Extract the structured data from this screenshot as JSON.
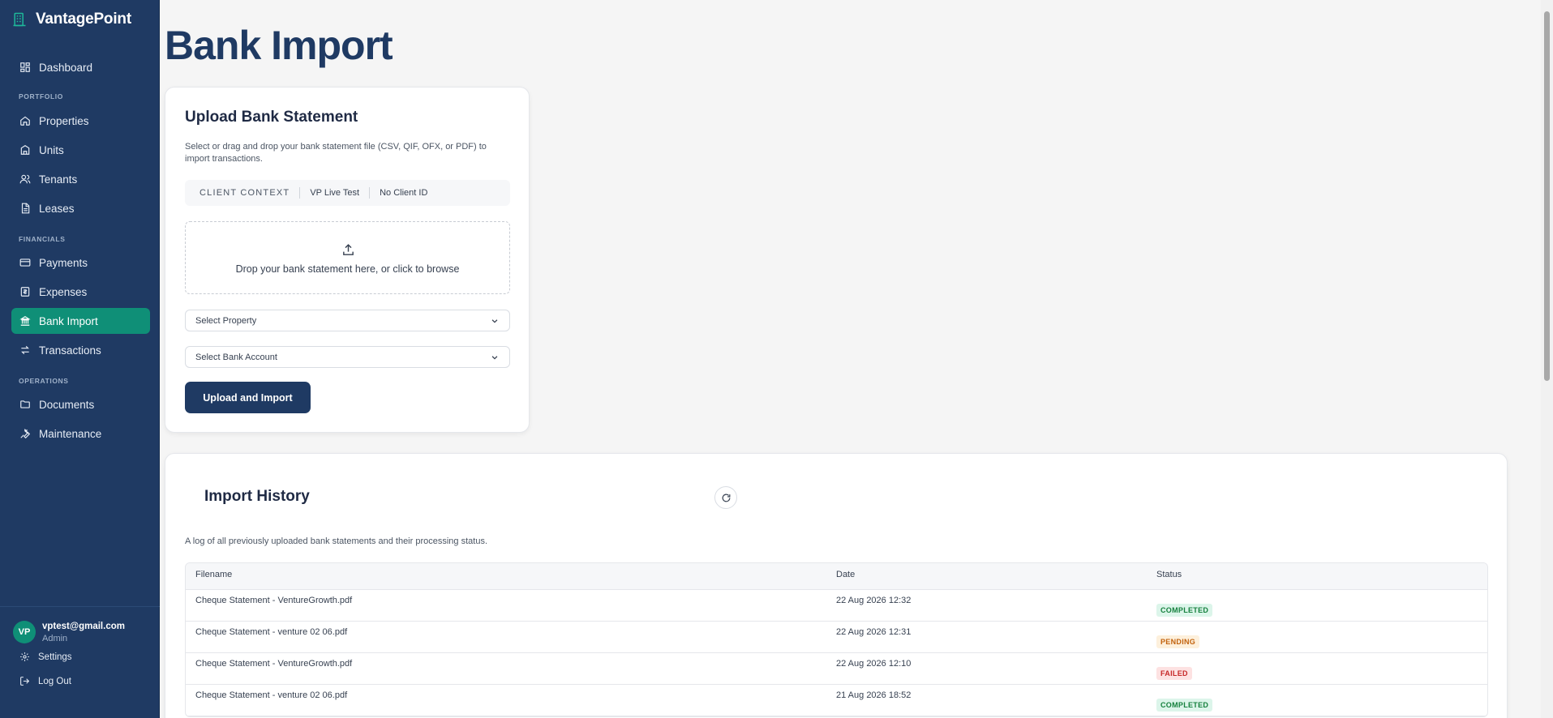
{
  "app": {
    "brand": "VantagePoint",
    "page_title": "Bank Import"
  },
  "sidebar": {
    "dashboard": "Dashboard",
    "sections": {
      "portfolio": "PORTFOLIO",
      "financials": "FINANCIALS",
      "operations": "OPERATIONS"
    },
    "portfolio_items": [
      "Properties",
      "Units",
      "Tenants",
      "Leases"
    ],
    "financial_items": [
      "Payments",
      "Expenses",
      "Bank Import",
      "Transactions"
    ],
    "operation_items": [
      "Documents",
      "Maintenance"
    ],
    "active_item": "Bank Import",
    "user": {
      "initials": "VP",
      "email": "vptest@gmail.com",
      "role": "Admin"
    },
    "settings_label": "Settings",
    "logout_label": "Log Out"
  },
  "upload": {
    "title": "Upload Bank Statement",
    "description": "Select or drag and drop your bank statement file (CSV, QIF, OFX, or PDF) to import transactions.",
    "context": {
      "label": "CLIENT CONTEXT",
      "client": "VP Live Test",
      "client_id": "No Client ID"
    },
    "dropzone_text": "Drop your bank statement here, or click to browse",
    "property_select": "Select Property",
    "account_select": "Select Bank Account",
    "submit_label": "Upload and Import"
  },
  "history": {
    "title": "Import History",
    "description": "A log of all previously uploaded bank statements and their processing status.",
    "columns": {
      "filename": "Filename",
      "date": "Date",
      "status": "Status"
    },
    "rows": [
      {
        "filename": "Cheque Statement - VentureGrowth.pdf",
        "date": "22 Aug 2026 12:32",
        "status": "COMPLETED"
      },
      {
        "filename": "Cheque Statement - venture 02 06.pdf",
        "date": "22 Aug 2026 12:31",
        "status": "PENDING"
      },
      {
        "filename": "Cheque Statement - VentureGrowth.pdf",
        "date": "22 Aug 2026 12:10",
        "status": "FAILED"
      },
      {
        "filename": "Cheque Statement - venture 02 06.pdf",
        "date": "21 Aug 2026 18:52",
        "status": "COMPLETED"
      }
    ]
  },
  "colors": {
    "sidebar": "#1f3a63",
    "accent": "#0f8f77",
    "completed": "#15803d",
    "pending": "#c2620c",
    "failed": "#c62828"
  }
}
